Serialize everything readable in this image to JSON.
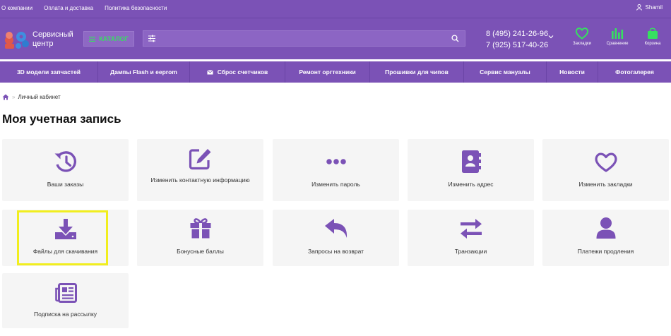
{
  "topbar": {
    "links": [
      "О компании",
      "Оплата и доставка",
      "Политика безопасности"
    ],
    "user": "Shamil"
  },
  "header": {
    "logo_line1": "Сервисный",
    "logo_line2": "центр",
    "catalog_label": "КАТАЛОГ",
    "search_placeholder": "",
    "phone1": "8 (495) 241-26-96",
    "phone2": "7 (925) 517-40-26",
    "bookmarks_label": "Закладки",
    "compare_label": "Сравнение",
    "cart_label": "Корзина"
  },
  "nav": {
    "items": [
      "3D модели запчастей",
      "Дампы Flash и eeprom",
      "Сброс счетчиков",
      "Ремонт оргтехники",
      "Прошивки для чипов",
      "Сервис мануалы",
      "Новости",
      "Фотогалерея"
    ]
  },
  "breadcrumb": {
    "current": "Личный кабинет"
  },
  "page_title": "Моя учетная запись",
  "tiles": [
    {
      "label": "Ваши заказы",
      "icon": "history-icon"
    },
    {
      "label": "Изменить контактную информацию",
      "icon": "edit-icon"
    },
    {
      "label": "Изменить пароль",
      "icon": "ellipsis-icon"
    },
    {
      "label": "Изменить адрес",
      "icon": "address-book-icon"
    },
    {
      "label": "Изменить закладки",
      "icon": "heart-icon"
    },
    {
      "label": "Файлы для скачивания",
      "icon": "download-icon"
    },
    {
      "label": "Бонусные баллы",
      "icon": "gift-icon"
    },
    {
      "label": "Запросы на возврат",
      "icon": "reply-icon"
    },
    {
      "label": "Транзакции",
      "icon": "exchange-icon"
    },
    {
      "label": "Платежи продления",
      "icon": "user-icon"
    },
    {
      "label": "Подписка на рассылку",
      "icon": "newspaper-icon"
    }
  ],
  "colors": {
    "brand": "#7b52b6",
    "icon": "#7b52b6",
    "highlight": "#f1ee1f",
    "accent_green": "#36e060"
  }
}
